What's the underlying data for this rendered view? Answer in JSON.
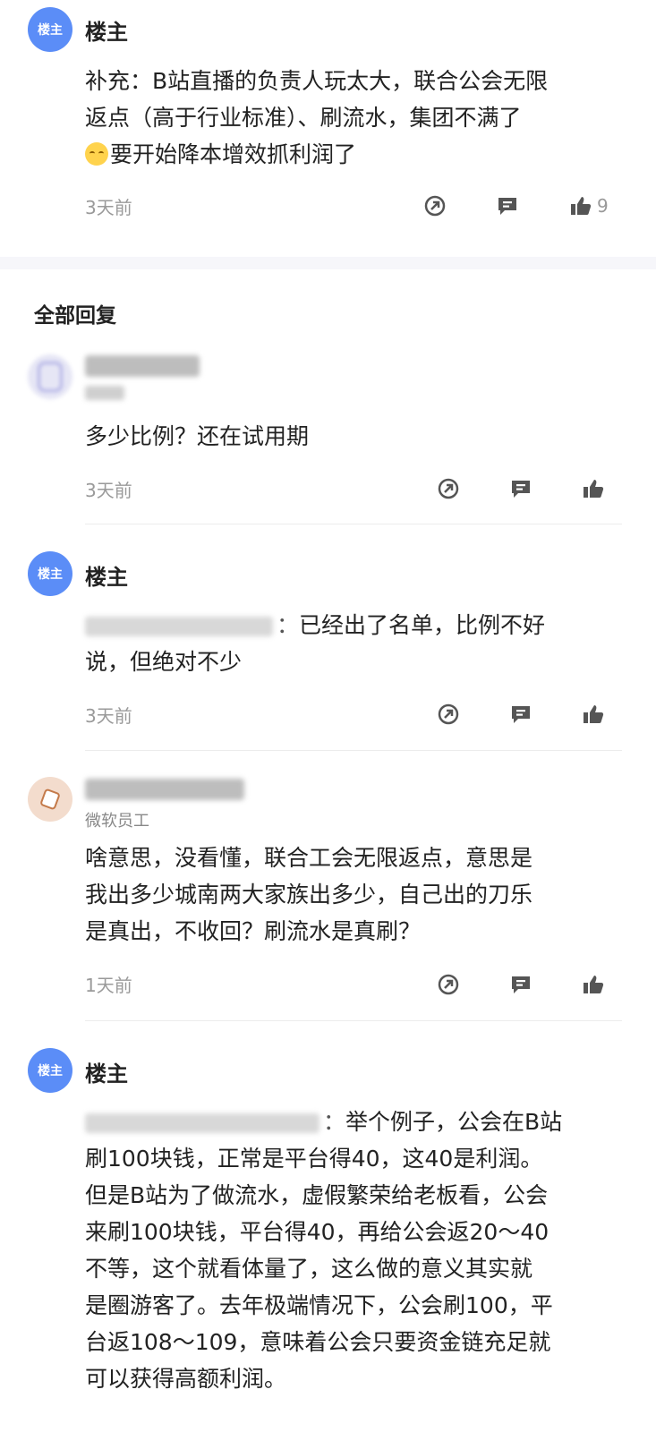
{
  "op_label": "楼主",
  "main_post": {
    "name": "楼主",
    "line1": "补充：B站直播的负责人玩太大，联合公会无限",
    "line2": "返点（高于行业标准）、刷流水，集团不满了",
    "line3": "要开始降本增效抓利润了",
    "time": "3天前",
    "likes": "9"
  },
  "section_title": "全部回复",
  "replies": [
    {
      "text": "多少比例？还在试用期",
      "time": "3天前"
    },
    {
      "name": "楼主",
      "colon": "：",
      "line1": "已经出了名单，比例不好",
      "line2": "说，但绝对不少",
      "time": "3天前"
    },
    {
      "subtitle": "微软员工",
      "line1": "啥意思，没看懂，联合工会无限返点，意思是",
      "line2": "我出多少城南两大家族出多少，自己出的刀乐",
      "line3": "是真出，不收回？刷流水是真刷？",
      "time": "1天前"
    },
    {
      "name": "楼主",
      "colon": "：",
      "line1": "举个例子，公会在B站",
      "line2": "刷100块钱，正常是平台得40，这40是利润。",
      "line3": "但是B站为了做流水，虚假繁荣给老板看，公会",
      "line4": "来刷100块钱，平台得40，再给公会返20～40",
      "line5": "不等，这个就看体量了，这么做的意义其实就",
      "line6": "是圈游客了。去年极端情况下，公会刷100，平",
      "line7": "台返108～109，意味着公会只要资金链充足就",
      "line8": "可以获得高额利润。"
    }
  ],
  "colors": {
    "accent": "#5b8df7",
    "icon": "#555555",
    "muted": "#9a9a9a"
  }
}
